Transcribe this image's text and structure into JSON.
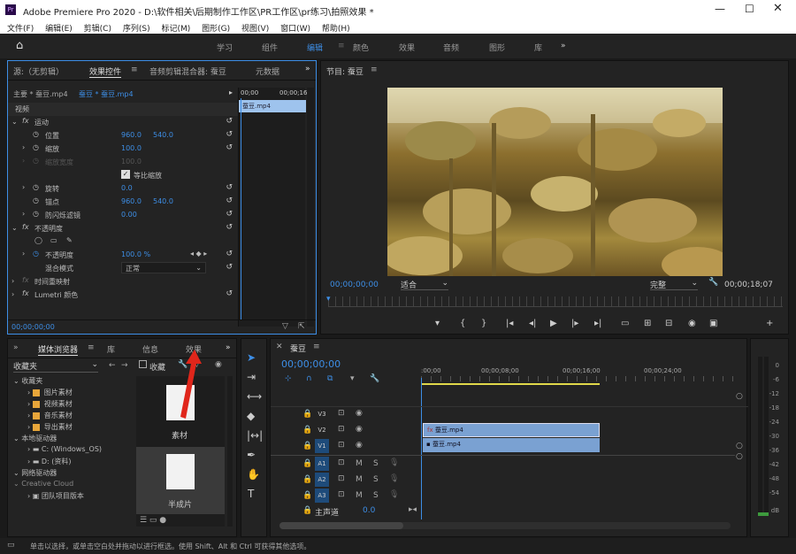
{
  "app": {
    "title": "Adobe Premiere Pro 2020 - D:\\软件相关\\后期制作工作区\\PR工作区\\pr练习\\拍照效果 *"
  },
  "menu": [
    "文件(F)",
    "编辑(E)",
    "剪辑(C)",
    "序列(S)",
    "标记(M)",
    "图形(G)",
    "视图(V)",
    "窗口(W)",
    "帮助(H)"
  ],
  "workspaces": {
    "learn": "学习",
    "assembly": "组件",
    "edit": "编辑",
    "color": "颜色",
    "effects": "效果",
    "audio": "音频",
    "graphics": "图形",
    "library": "库"
  },
  "source_panel": {
    "tab_source": "源:（无剪辑）",
    "tab_effect_controls": "效果控件",
    "tab_audio_mixer": "音频剪辑混合器: 蚕豆",
    "tab_metadata": "元数据",
    "master": "主要 * 蚕豆.mp4",
    "seq": "蚕豆 * 蚕豆.mp4",
    "tc_start": "00;00",
    "tc_end": "00;00;16",
    "clip": "蚕豆.mp4",
    "timecode": "00;00;00;00"
  },
  "effects": {
    "video": "视频",
    "motion": "运动",
    "position": "位置",
    "pos_x": "960.0",
    "pos_y": "540.0",
    "scale": "缩放",
    "scale_v": "100.0",
    "scale_w": "缩放宽度",
    "scale_w_v": "100.0",
    "uniform": "等比缩放",
    "rotation": "旋转",
    "rotation_v": "0.0",
    "anchor": "锚点",
    "anchor_x": "960.0",
    "anchor_y": "540.0",
    "flicker": "防闪烁滤镜",
    "flicker_v": "0.00",
    "opacity_group": "不透明度",
    "opacity": "不透明度",
    "opacity_v": "100.0 %",
    "blend": "混合模式",
    "blend_v": "正常",
    "remap": "时间重映射",
    "lumetri": "Lumetri 颜色"
  },
  "program": {
    "title": "节目: 蚕豆",
    "timecode": "00;00;00;00",
    "fit": "适合",
    "quality": "完整",
    "duration": "00;00;18;07"
  },
  "project": {
    "tab_media": "媒体浏览器",
    "tab_lib": "库",
    "tab_info": "信息",
    "tab_effects": "效果",
    "favorites": "收藏夹",
    "collect": "收藏",
    "tree": [
      "收藏夹",
      "图片素材",
      "视频素材",
      "音乐素材",
      "导出素材",
      "本地驱动器",
      "C: (Windows_OS)",
      "D: (资料)",
      "网络驱动器",
      "Creative Cloud",
      "团队项目版本"
    ],
    "thumb1": "素材",
    "thumb2": "半成片"
  },
  "timeline": {
    "tab": "蚕豆",
    "timecode": "00;00;00;00",
    "ruler": [
      ":00;00",
      "00;00;08;00",
      "00;00;16;00",
      "00;00;24;00"
    ],
    "tracks": {
      "v3": "V3",
      "v2": "V2",
      "v1": "V1",
      "a1": "A1",
      "a2": "A2",
      "a3": "A3",
      "master": "主声道",
      "master_v": "0.0"
    },
    "clip_v2": "蚕豆.mp4",
    "clip_v1": "蚕豆.mp4",
    "m": "M",
    "s": "S"
  },
  "meter": [
    "0",
    "-6",
    "-12",
    "-18",
    "-24",
    "-30",
    "-36",
    "-42",
    "-48",
    "-54",
    "dB"
  ],
  "status": "单击以选择，或单击空白处并拖动以进行框选。使用 Shift、Alt 和 Ctrl 可获得其他选项。",
  "colors": {
    "accent": "#3d8ee6",
    "clip": "#7aa1d2",
    "folder": "#e8a63a"
  }
}
